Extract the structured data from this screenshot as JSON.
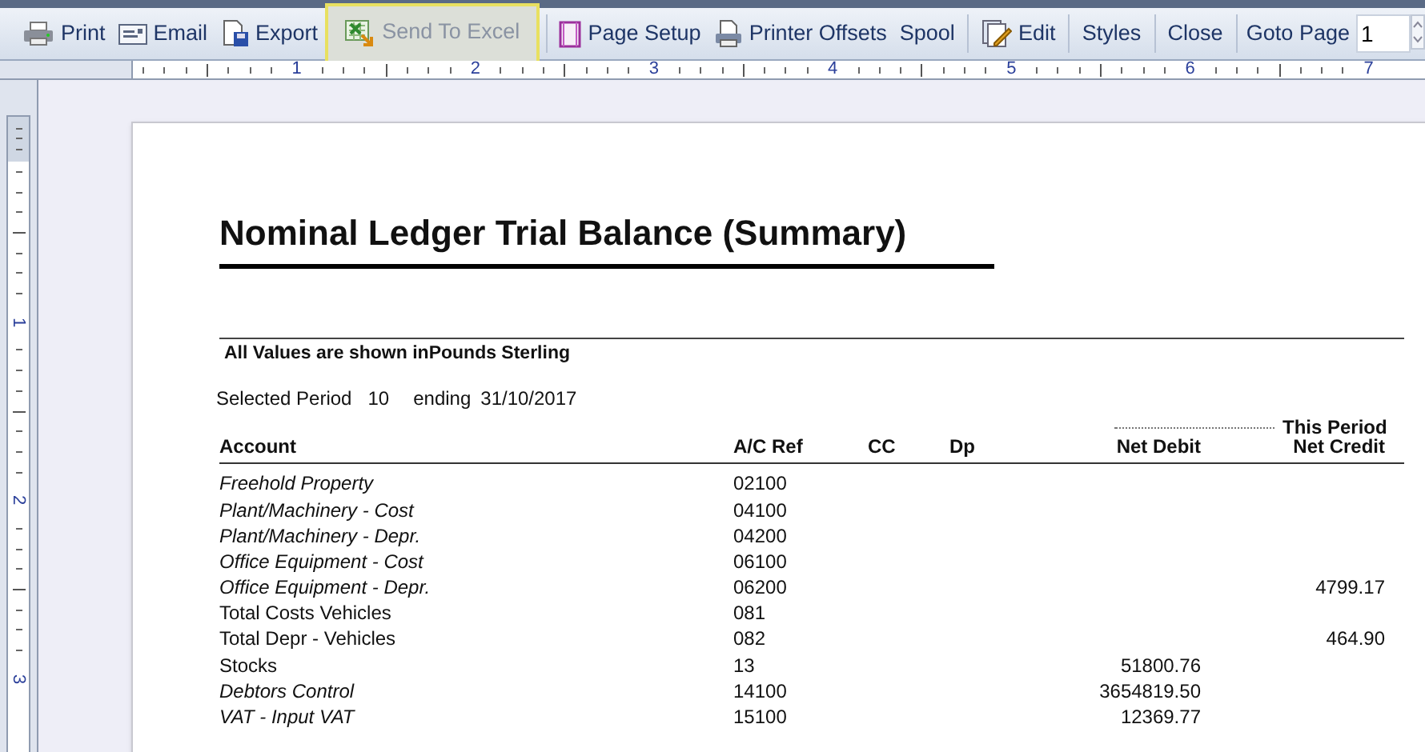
{
  "toolbar": {
    "items": [
      {
        "kind": "button",
        "label": "Print",
        "highlighted": false,
        "disabled": false
      },
      {
        "kind": "button",
        "label": "Email",
        "highlighted": false,
        "disabled": false
      },
      {
        "kind": "button",
        "label": "Export",
        "highlighted": false,
        "disabled": false
      },
      {
        "kind": "button",
        "label": "Send To Excel",
        "highlighted": true,
        "disabled": true
      },
      {
        "kind": "separator"
      },
      {
        "kind": "button",
        "label": "Page Setup",
        "highlighted": false,
        "disabled": false
      },
      {
        "kind": "button",
        "label": "Printer Offsets",
        "highlighted": false,
        "disabled": false
      },
      {
        "kind": "button",
        "label": "Spool",
        "highlighted": false,
        "disabled": false
      },
      {
        "kind": "separator"
      },
      {
        "kind": "button",
        "label": "Edit",
        "highlighted": false,
        "disabled": false
      },
      {
        "kind": "separator"
      },
      {
        "kind": "button",
        "label": "Styles",
        "highlighted": false,
        "disabled": false
      },
      {
        "kind": "separator"
      },
      {
        "kind": "button",
        "label": "Close",
        "highlighted": false,
        "disabled": false
      },
      {
        "kind": "separator"
      }
    ],
    "goto_page": {
      "label": "Goto Page",
      "value": "1"
    }
  },
  "ruler": {
    "horizontal_labels": [
      "1",
      "2",
      "3",
      "4",
      "5",
      "6",
      "7"
    ],
    "vertical_labels": [
      "1",
      "2",
      "3"
    ]
  },
  "report": {
    "title": "Nominal Ledger Trial Balance (Summary)",
    "currency_note": "All Values are shown inPounds Sterling",
    "period_label": "Selected Period",
    "period": "10",
    "ending_label": "ending",
    "ending_date": "31/10/2017",
    "group_header": "This Period",
    "columns": [
      "Account",
      "A/C Ref",
      "CC",
      "Dp",
      "Net Debit",
      "Net Credit"
    ],
    "rows": [
      {
        "account": "Freehold Property",
        "ac_ref": "02100",
        "italic": true
      },
      {
        "account": "Plant/Machinery - Cost",
        "ac_ref": "04100",
        "italic": true
      },
      {
        "account": "Plant/Machinery - Depr.",
        "ac_ref": "04200",
        "italic": true
      },
      {
        "account": "Office Equipment - Cost",
        "ac_ref": "06100",
        "italic": true
      },
      {
        "account": "Office Equipment - Depr.",
        "ac_ref": "06200",
        "net_credit": "4799.17",
        "italic": true
      },
      {
        "account": "Total Costs Vehicles",
        "ac_ref": "081",
        "italic": false
      },
      {
        "account": "Total Depr - Vehicles",
        "ac_ref": "082",
        "net_credit": "464.90",
        "italic": false
      },
      {
        "account": "Stocks",
        "ac_ref": "13",
        "net_debit": "51800.76",
        "italic": false
      },
      {
        "account": "Debtors Control",
        "ac_ref": "14100",
        "net_debit": "3654819.50",
        "italic": true
      },
      {
        "account": "VAT - Input VAT",
        "ac_ref": "15100",
        "net_debit": "12369.77",
        "italic": true
      }
    ]
  }
}
